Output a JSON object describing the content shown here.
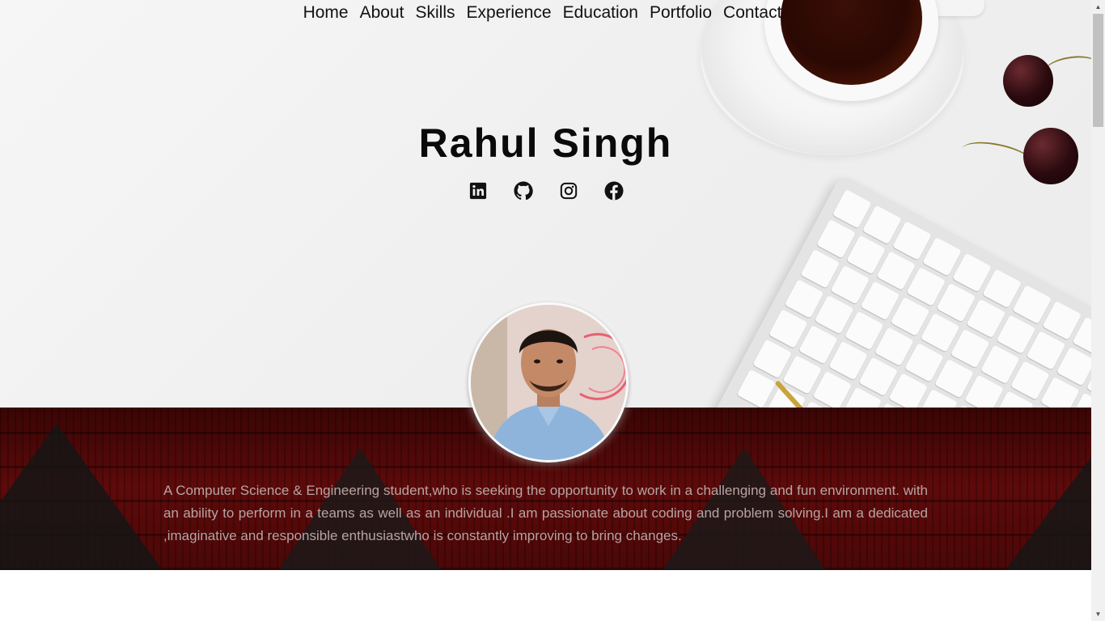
{
  "nav": {
    "items": [
      "Home",
      "About",
      "Skills",
      "Experience",
      "Education",
      "Portfolio",
      "Contact"
    ]
  },
  "hero": {
    "name": "Rahul Singh",
    "socials": [
      "linkedin-icon",
      "github-icon",
      "instagram-icon",
      "facebook-icon"
    ]
  },
  "about": {
    "text": "A Computer Science & Engineering student,who is seeking the opportunity to work in a challenging and fun environment. with an ability to perform in a teams as well as an individual .I am passionate about coding and problem solving.I am a dedicated ,imaginative and responsible enthusiastwho is constantly improving to bring changes."
  },
  "colors": {
    "about_bg": "#4d0808",
    "about_text": "#b9a3a3",
    "name": "#0a0a0a"
  }
}
